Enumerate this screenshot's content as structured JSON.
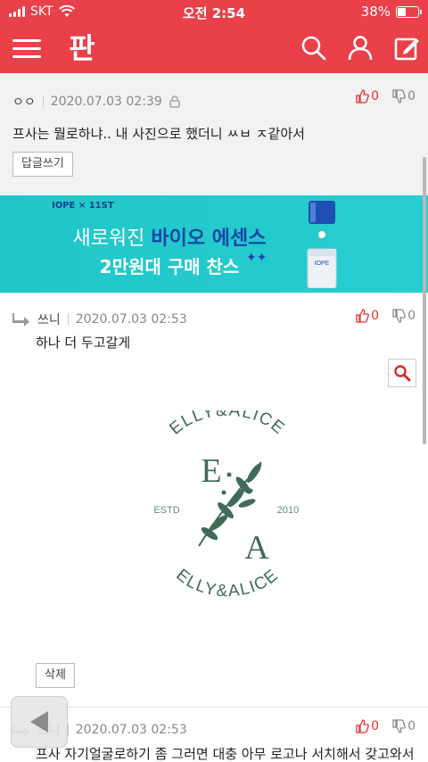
{
  "status_bar": {
    "carrier": "SKT",
    "time": "오전 2:54",
    "battery_percent": "38%",
    "battery_level": 0.38
  },
  "header": {
    "logo_text": "판",
    "icons": [
      "menu-icon",
      "search-icon",
      "user-icon",
      "edit-icon"
    ]
  },
  "comments": [
    {
      "author": "ㅇㅇ",
      "timestamp": "2020.07.03 02:39",
      "text": "프사는 뭘로하냐.. 내 사진으로 했더니 ㅆㅂ ㅈ같아서",
      "upvotes": "0",
      "downvotes": "0",
      "action_label": "답글쓰기"
    },
    {
      "author": "쓰니",
      "timestamp": "2020.07.03 02:53",
      "text": "하나 더 두고갈게",
      "upvotes": "0",
      "downvotes": "0",
      "action_label": "삭제",
      "image": {
        "top_text": "ELLY&ALICE",
        "bottom_text": "ELLY&ALICE",
        "letter1": "E",
        "letter2": "A",
        "left_text": "ESTD",
        "right_text": "2010"
      }
    },
    {
      "author": "쓰니",
      "timestamp": "2020.07.03 02:53",
      "text": "프사 자기얼굴로하기 좀 그러면 대충 아무 로고나 서치해서 갖고와서",
      "upvotes": "0",
      "downvotes": "0"
    }
  ],
  "ad": {
    "brand": "IOPE × 11ST",
    "line1_prefix": "새로워진 ",
    "line1_highlight": "바이오 에센스",
    "line2": "2만원대 구매 찬스",
    "product_label": "IOPE"
  },
  "colors": {
    "header_bg": "#e9404a",
    "upvote": "#e2352f",
    "ad_bg": "#21c6c9",
    "ad_highlight": "#1546a8",
    "logo_green": "#3f6b58"
  }
}
